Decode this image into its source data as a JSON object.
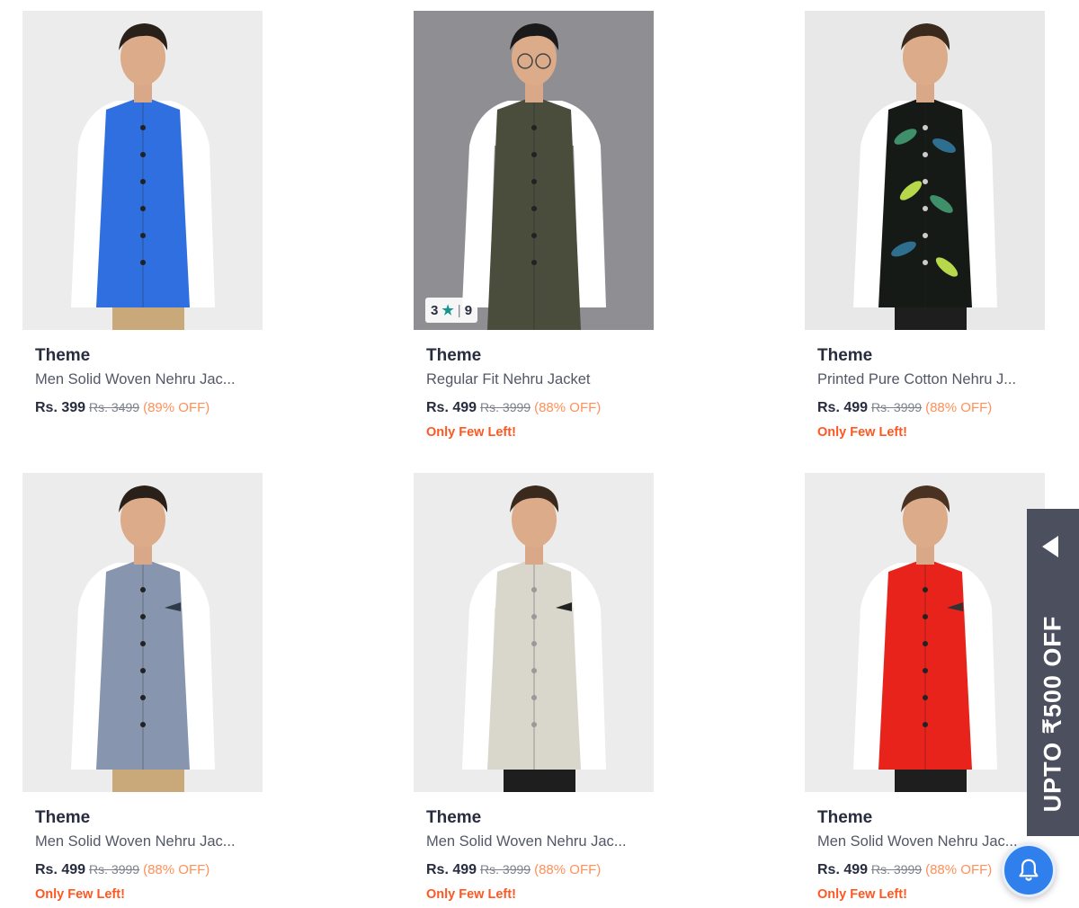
{
  "products": [
    {
      "brand": "Theme",
      "name": "Men Solid Woven Nehru Jac...",
      "price": "Rs. 399",
      "mrp": "Rs. 3499",
      "discount": "(89% OFF)",
      "stock_note": "",
      "vest_color": "#2f6fe0",
      "bg_color": "#ececec"
    },
    {
      "brand": "Theme",
      "name": "Regular Fit Nehru Jacket",
      "price": "Rs. 499",
      "mrp": "Rs. 3999",
      "discount": "(88% OFF)",
      "stock_note": "Only Few Left!",
      "vest_color": "#4a4c3c",
      "bg_color": "#8e8e93",
      "rating": {
        "value": "3",
        "count": "9"
      }
    },
    {
      "brand": "Theme",
      "name": "Printed Pure Cotton Nehru J...",
      "price": "Rs. 499",
      "mrp": "Rs. 3999",
      "discount": "(88% OFF)",
      "stock_note": "Only Few Left!",
      "vest_color": "#161a17",
      "bg_color": "#e8e8e8"
    },
    {
      "brand": "Theme",
      "name": "Men Solid Woven Nehru Jac...",
      "price": "Rs. 499",
      "mrp": "Rs. 3999",
      "discount": "(88% OFF)",
      "stock_note": "Only Few Left!",
      "vest_color": "#8796ae",
      "bg_color": "#ececec"
    },
    {
      "brand": "Theme",
      "name": "Men Solid Woven Nehru Jac...",
      "price": "Rs. 499",
      "mrp": "Rs. 3999",
      "discount": "(88% OFF)",
      "stock_note": "Only Few Left!",
      "vest_color": "#d9d6cc",
      "bg_color": "#ececec"
    },
    {
      "brand": "Theme",
      "name": "Men Solid Woven Nehru Jac...",
      "price": "Rs. 499",
      "mrp": "Rs. 3999",
      "discount": "(88% OFF)",
      "stock_note": "Only Few Left!",
      "vest_color": "#e8231c",
      "bg_color": "#ececec"
    }
  ],
  "promo": {
    "text": "UPTO ₹500 OFF",
    "icon": "chevron-left-icon"
  },
  "notification": {
    "icon": "bell-icon",
    "color": "#2f80ed"
  }
}
